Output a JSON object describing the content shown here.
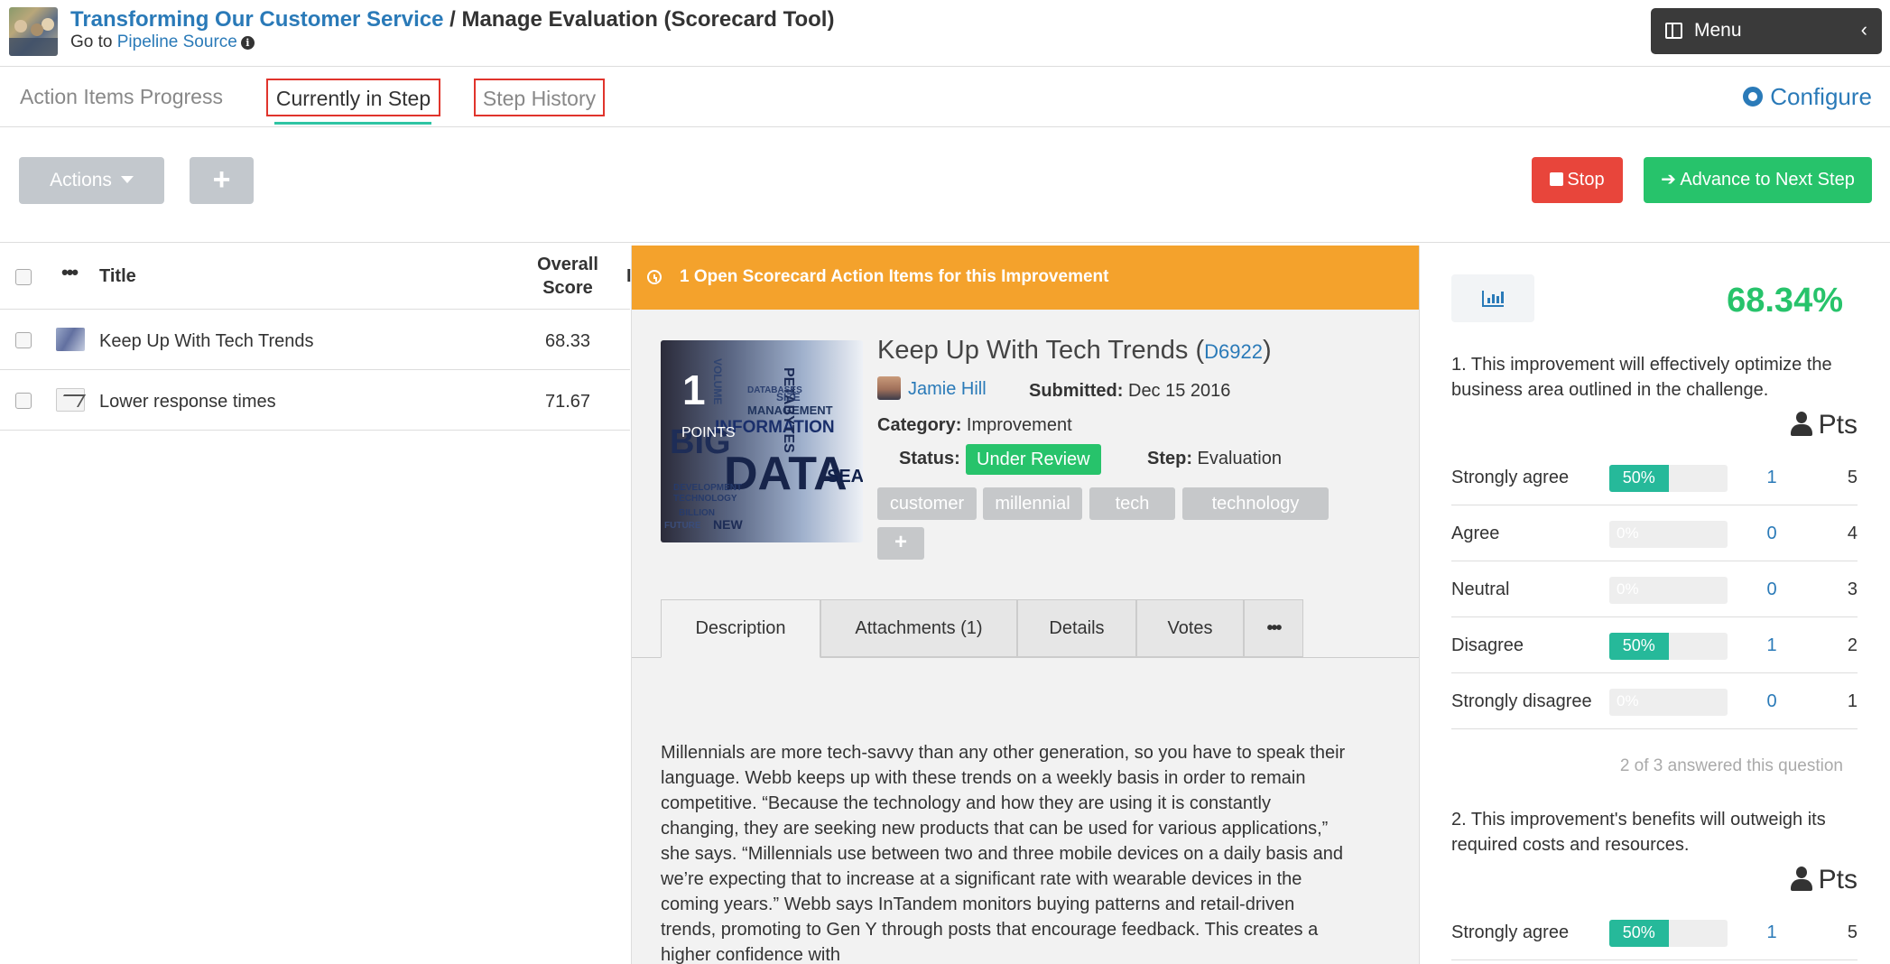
{
  "header": {
    "breadcrumb_link": "Transforming Our Customer Service",
    "breadcrumb_sep": " / ",
    "breadcrumb_current": "Manage Evaluation (Scorecard Tool)",
    "goto_prefix": "Go to ",
    "goto_link": "Pipeline Source",
    "menu_label": "Menu",
    "menu_chevron": "‹"
  },
  "tabs": {
    "progress": "Action Items Progress",
    "current": "Currently in Step",
    "history": "Step History",
    "configure": "Configure"
  },
  "toolbar": {
    "actions_label": "Actions",
    "add_label": "+",
    "stop_label": "Stop",
    "advance_label": "➔ Advance to Next Step"
  },
  "list": {
    "col_title": "Title",
    "col_score_line1": "Overall",
    "col_score_line2": "Score",
    "col_cut": "I",
    "rows": [
      {
        "title": "Keep Up With Tech Trends",
        "score": "68.33"
      },
      {
        "title": "Lower response times",
        "score": "71.67"
      }
    ]
  },
  "detail": {
    "alert": "1 Open Scorecard Action Items for this Improvement",
    "points_value": "1",
    "points_label": "POINTS",
    "image_words": [
      "BIG",
      "DATA",
      "INFORMATION",
      "MANAGEMENT",
      "PETABYTES",
      "TECHNOLOGY",
      "DEVELOPMENT",
      "VOLUME",
      "BILLION",
      "NEW",
      "FUTURE",
      "SEAR",
      "DATABASES",
      "SIZE"
    ],
    "title": "Keep Up With Tech Trends",
    "id_open": " (",
    "id": "D6922",
    "id_close": ")",
    "author": "Jamie Hill",
    "submitted_label": "Submitted:",
    "submitted_value": " Dec 15 2016",
    "category_label": "Category:",
    "category_value": " Improvement",
    "status_label": "Status:",
    "status_value": "Under Review",
    "step_label": "Step:",
    "step_value": " Evaluation",
    "tags": [
      "customer",
      "millennial",
      "tech",
      "technology"
    ],
    "tag_add": "+",
    "tabs": [
      "Description",
      "Attachments (1)",
      "Details",
      "Votes",
      "•••"
    ],
    "description": "Millennials are more tech-savvy than any other generation, so you have to speak their language. Webb keeps up with these trends on a weekly basis in order to remain competitive. “Because the technology and how they are using it is constantly changing, they are seeking new products that can be used for various applications,” she says. “Millennials use between two and three mobile devices on a daily basis and we’re expecting that to increase at a significant rate with wearable devices in the coming years.” Webb says InTandem monitors buying patterns and retail-driven trends, promoting to Gen Y through posts that encourage feedback. This creates a higher confidence with"
  },
  "scorecard": {
    "overall": "68.34%",
    "pts_label": "Pts",
    "colors": {
      "fill": "#26b99a",
      "overall": "#27c36b"
    },
    "questions": [
      {
        "text": "1. This improvement will effectively optimize the business area outlined in the challenge.",
        "answered": "2 of 3 answered this question",
        "options": [
          {
            "label": "Strongly agree",
            "pct_text": "50%",
            "pct": 50,
            "count": "1",
            "pts": "5"
          },
          {
            "label": "Agree",
            "pct_text": "0%",
            "pct": 0,
            "count": "0",
            "pts": "4"
          },
          {
            "label": "Neutral",
            "pct_text": "0%",
            "pct": 0,
            "count": "0",
            "pts": "3"
          },
          {
            "label": "Disagree",
            "pct_text": "50%",
            "pct": 50,
            "count": "1",
            "pts": "2"
          },
          {
            "label": "Strongly disagree",
            "pct_text": "0%",
            "pct": 0,
            "count": "0",
            "pts": "1"
          }
        ]
      },
      {
        "text": "2. This improvement's benefits will outweigh its required costs and resources.",
        "options": [
          {
            "label": "Strongly agree",
            "pct_text": "50%",
            "pct": 50,
            "count": "1",
            "pts": "5"
          }
        ]
      }
    ]
  }
}
